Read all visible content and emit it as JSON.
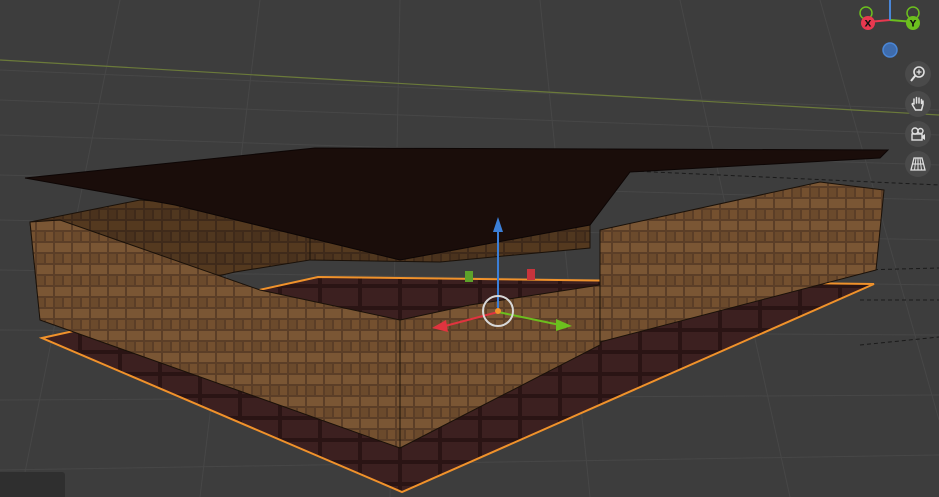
{
  "app": {
    "name": "3D Viewport"
  },
  "gizmo": {
    "x_label": "X",
    "y_label": "Y",
    "x_color": "#e8384f",
    "y_color": "#6cbf1e",
    "z_color": "#4a86d6"
  },
  "nav_tools": [
    {
      "name": "zoom",
      "icon": "zoom-icon"
    },
    {
      "name": "pan",
      "icon": "hand-icon"
    },
    {
      "name": "camera",
      "icon": "camera-icon"
    },
    {
      "name": "perspective",
      "icon": "grid-perspective-icon"
    }
  ],
  "colors": {
    "viewport_bg": "#3d3d3d",
    "grid_line": "#474747",
    "selection_outline": "#f0922b",
    "brick": "#6a4a2f",
    "roof": "#1a0d0a"
  },
  "scene": {
    "selected_object": "floor",
    "transform_gizmo": [
      "x-axis-arrow",
      "y-axis-arrow",
      "z-axis-arrow"
    ]
  }
}
